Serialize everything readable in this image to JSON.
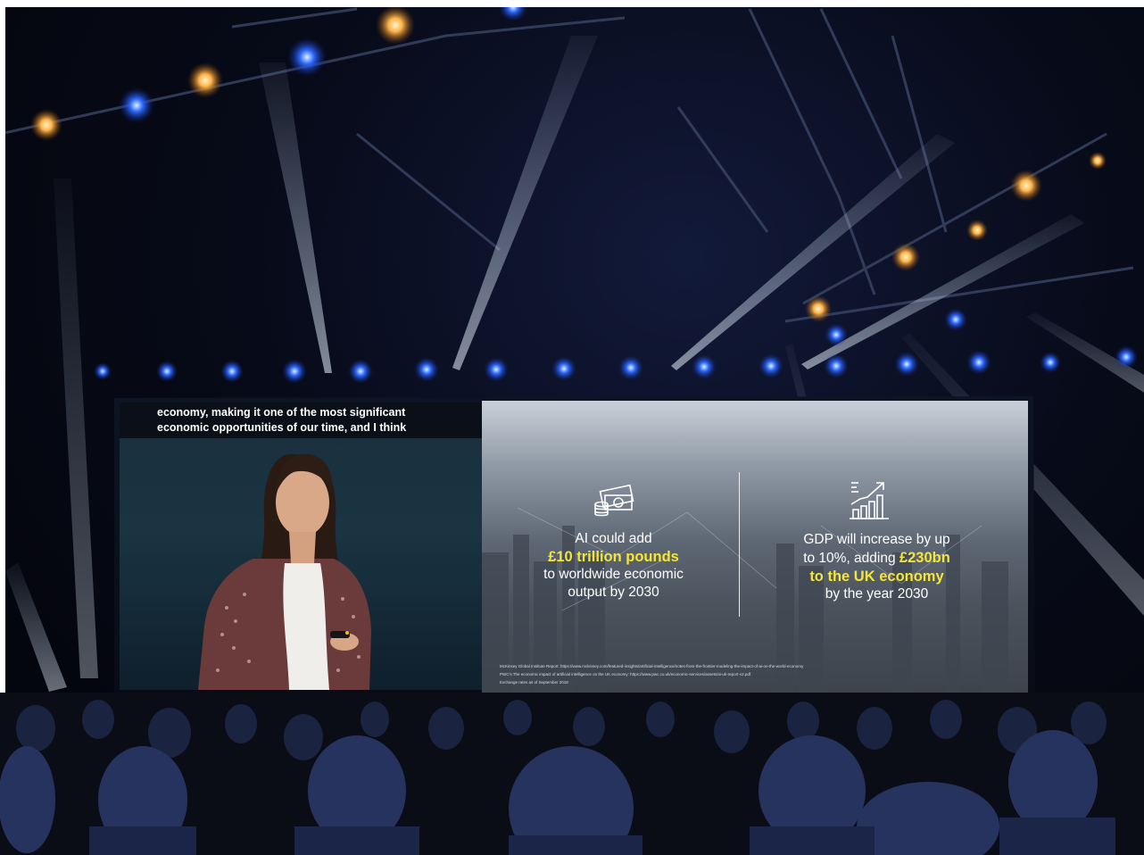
{
  "scene": {
    "description_colors": {
      "stage_blue": "#1c5cff",
      "warm_light": "#ffb347",
      "highlight_yellow": "#f5e53b"
    }
  },
  "caption": {
    "line1": "economy, making it one of the most significant",
    "line2": "economic opportunities of our time, and I think"
  },
  "slide": {
    "left_stat": {
      "icon": "money-icon",
      "line1": "AI could add",
      "highlight": "£10 trillion pounds",
      "line3": "to worldwide economic",
      "line4": "output by 2030"
    },
    "right_stat": {
      "icon": "growth-chart-icon",
      "line1": "GDP will increase by up",
      "line2": "to 10%, adding",
      "highlight_inline": "£230bn",
      "highlight": "to the UK economy",
      "line4": "by the year 2030"
    },
    "footnotes": [
      "McKinsey Global Institute Report: https://www.mckinsey.com/featured-insights/artificial-intelligence/notes-from-the-frontier-modeling-the-impact-of-ai-on-the-world-economy",
      "PWC's The economic impact of artificial intelligence on the UK economy: https://www.pwc.co.uk/economic-services/assets/ai-uk-report-v2.pdf",
      "Exchange rates as of September 2018"
    ]
  }
}
